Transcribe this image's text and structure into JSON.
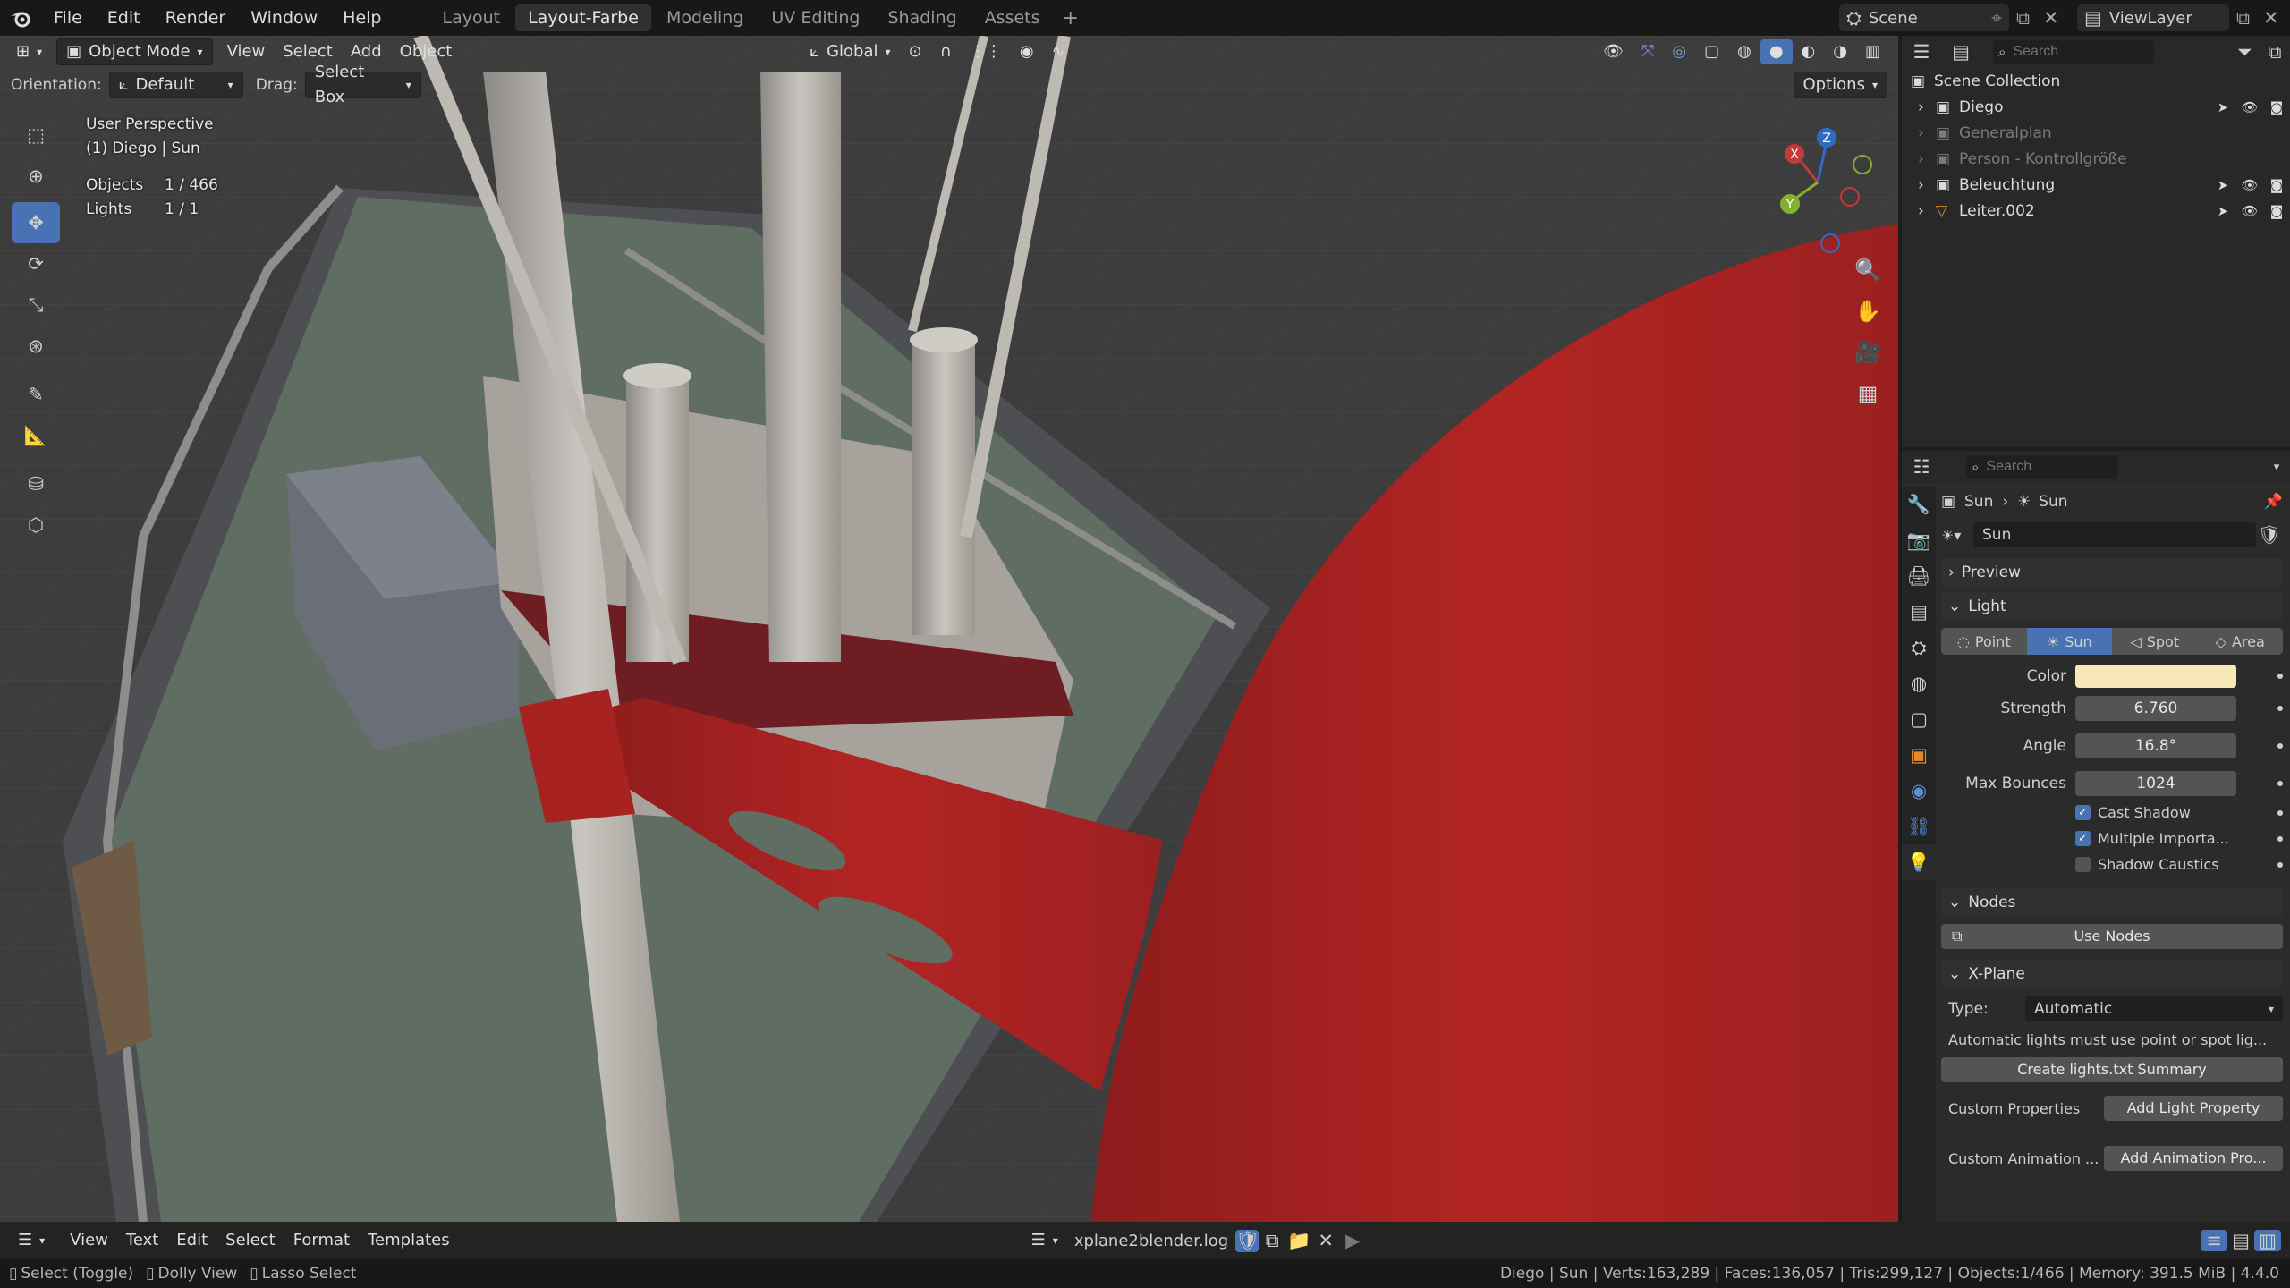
{
  "topbar": {
    "menus": [
      "File",
      "Edit",
      "Render",
      "Window",
      "Help"
    ],
    "workspaces": [
      "Layout",
      "Layout-Farbe",
      "Modeling",
      "UV Editing",
      "Shading",
      "Assets"
    ],
    "active_workspace_index": 1,
    "scene_label": "Scene",
    "viewlayer_label": "ViewLayer"
  },
  "viewport": {
    "mode": "Object Mode",
    "menus": [
      "View",
      "Select",
      "Add",
      "Object"
    ],
    "transform_orientation": "Global",
    "orientation_label": "Orientation:",
    "orientation_value": "Default",
    "drag_label": "Drag:",
    "drag_value": "Select Box",
    "options_label": "Options",
    "overlay": {
      "perspective": "User Perspective",
      "context": "(1) Diego | Sun",
      "objects_label": "Objects",
      "objects_value": "1 / 466",
      "lights_label": "Lights",
      "lights_value": "1 / 1"
    },
    "gizmo_axes": [
      "X",
      "Y",
      "Z"
    ]
  },
  "outliner": {
    "search_placeholder": "Search",
    "root": "Scene Collection",
    "items": [
      {
        "label": "Diego",
        "dim": false
      },
      {
        "label": "Generalplan",
        "dim": true
      },
      {
        "label": "Person - Kontrollgröße",
        "dim": true
      },
      {
        "label": "Beleuchtung",
        "dim": false
      },
      {
        "label": "Leiter.002",
        "dim": false
      }
    ]
  },
  "properties": {
    "search_placeholder": "Search",
    "breadcrumb": [
      "Sun",
      "Sun"
    ],
    "datablock_name": "Sun",
    "panels": {
      "preview": "Preview",
      "light": "Light",
      "nodes": "Nodes",
      "xplane": "X-Plane"
    },
    "light_types": [
      "Point",
      "Sun",
      "Spot",
      "Area"
    ],
    "active_light_type_index": 1,
    "color_label": "Color",
    "light_color": "#f8e7b8",
    "strength_label": "Strength",
    "strength_value": "6.760",
    "angle_label": "Angle",
    "angle_value": "16.8°",
    "max_bounces_label": "Max Bounces",
    "max_bounces_value": "1024",
    "checkboxes": [
      {
        "label": "Cast Shadow",
        "checked": true
      },
      {
        "label": "Multiple Importa...",
        "checked": true
      },
      {
        "label": "Shadow Caustics",
        "checked": false
      }
    ],
    "use_nodes_label": "Use Nodes",
    "type_label": "Type:",
    "type_value": "Automatic",
    "xplane_note": "Automatic lights must use point or spot lig...",
    "create_lights_label": "Create lights.txt Summary",
    "custom_properties_label": "Custom Properties",
    "add_light_property_label": "Add Light Property",
    "custom_animation_label": "Custom Animation ...",
    "add_animation_label": "Add Animation Pro..."
  },
  "text_editor": {
    "menus": [
      "View",
      "Text",
      "Edit",
      "Select",
      "Format",
      "Templates"
    ],
    "filename": "xplane2blender.log"
  },
  "statusbar": {
    "hints": [
      "Select (Toggle)",
      "Dolly View",
      "Lasso Select"
    ],
    "stats": "Diego | Sun | Verts:163,289 | Faces:136,057 | Tris:299,127 | Objects:1/466 | Memory: 391.5 MiB | 4.4.0"
  },
  "colors": {
    "accent": "#4772b3",
    "ship_red": "#b32424",
    "deck_green": "#5f6d62"
  }
}
